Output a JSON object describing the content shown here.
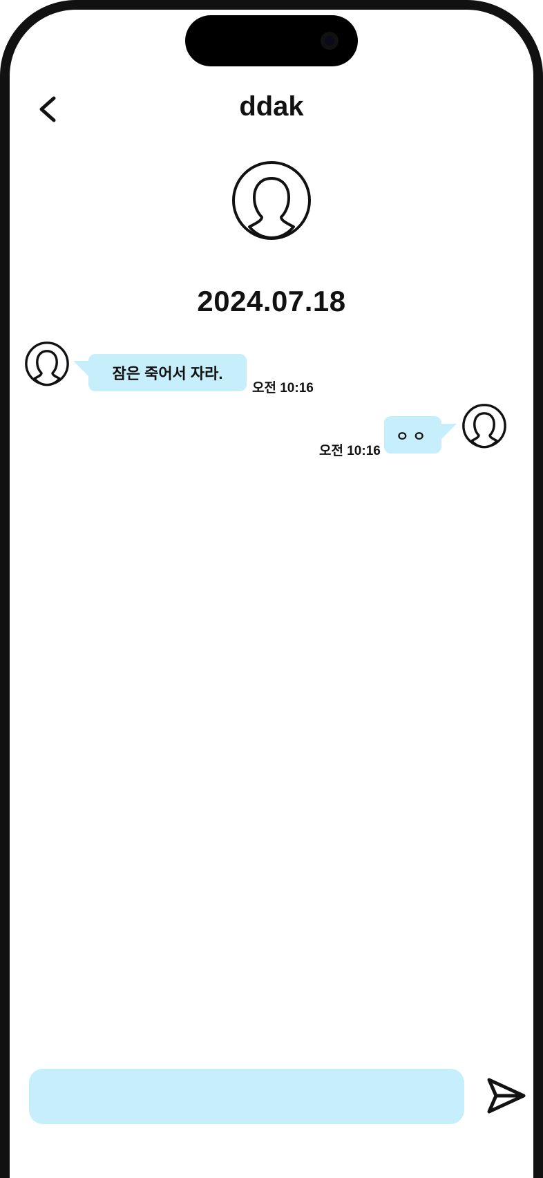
{
  "header": {
    "title": "ddak",
    "back_icon": "chevron-left-icon"
  },
  "profile": {
    "avatar_icon": "user-avatar-icon"
  },
  "chat": {
    "date": "2024.07.18",
    "messages": [
      {
        "sender": "other",
        "text": "잠은 죽어서 자라.",
        "time": "오전 10:16"
      },
      {
        "sender": "me",
        "text": "ㅇㅇ",
        "time": "오전 10:16"
      }
    ]
  },
  "composer": {
    "placeholder": "",
    "send_icon": "send-icon"
  },
  "colors": {
    "bubble": "#c6eefb",
    "input": "#c6eefb",
    "text": "#111111"
  }
}
